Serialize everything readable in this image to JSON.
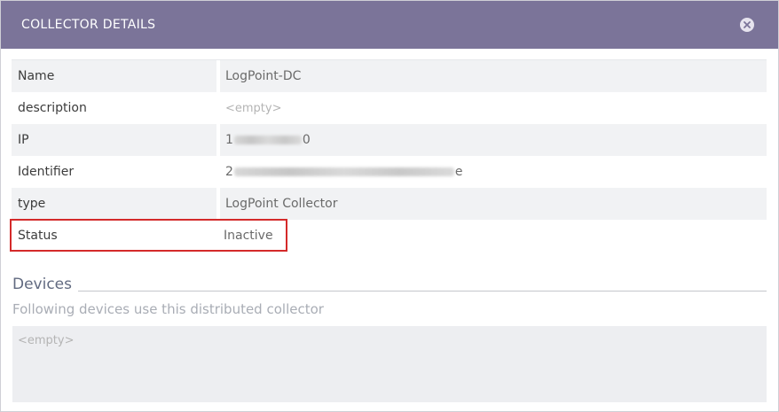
{
  "dialog": {
    "title": "COLLECTOR DETAILS",
    "close_icon": "close-circle-icon"
  },
  "details": {
    "rows": [
      {
        "label": "Name",
        "value": "LogPoint-DC"
      },
      {
        "label": "description",
        "value": "<empty>"
      },
      {
        "label": "IP",
        "value_prefix": "1",
        "value_suffix": "0"
      },
      {
        "label": "Identifier",
        "value_prefix": "2",
        "value_suffix": "e"
      },
      {
        "label": "type",
        "value": "LogPoint Collector"
      },
      {
        "label": "Status",
        "value": "Inactive"
      }
    ]
  },
  "devices": {
    "title": "Devices",
    "subtitle": "Following devices use this distributed collector",
    "empty_text": "<empty>"
  },
  "colors": {
    "header_bg": "#7b7499",
    "highlight_border": "#d42a2a",
    "row_shade": "#f1f2f4"
  }
}
